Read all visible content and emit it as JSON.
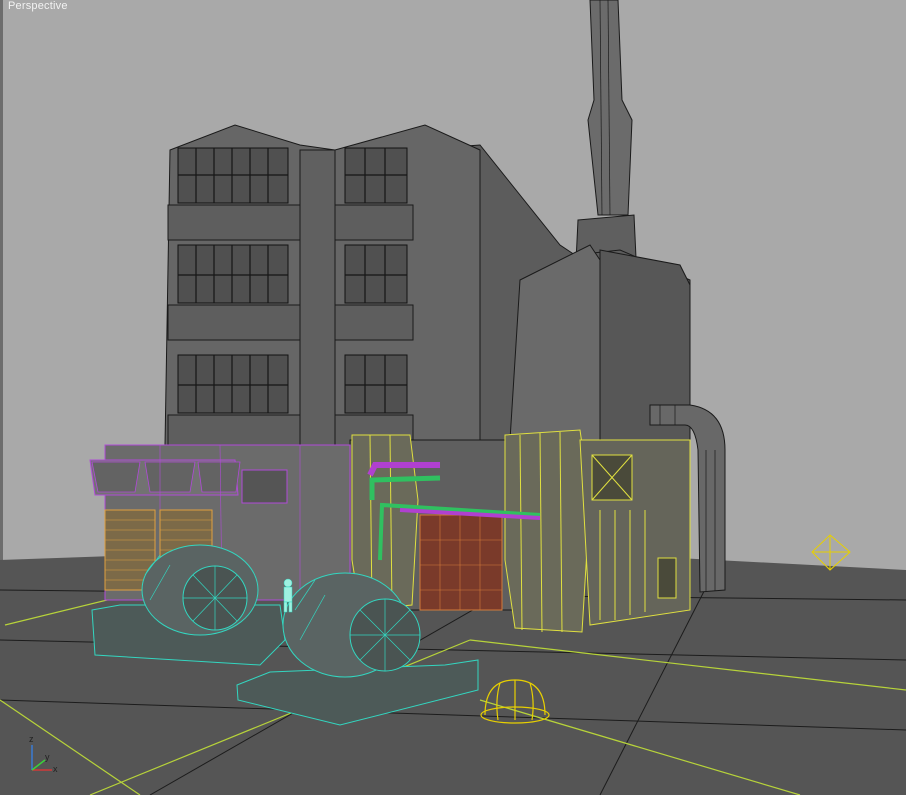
{
  "viewport": {
    "label": "Perspective",
    "background_color": "#a9a9a9",
    "grid_color": "#222222",
    "ground_line_color": "#b7d33a"
  },
  "scene": {
    "objects": [
      {
        "name": "factory-building",
        "type": "mesh",
        "wire_color": "#1a1a1a",
        "selected": false
      },
      {
        "name": "smokestack",
        "type": "mesh",
        "wire_color": "#1a1a1a",
        "selected": false
      },
      {
        "name": "purple-annex",
        "type": "mesh",
        "wire_color": "#a040c8",
        "selected": true
      },
      {
        "name": "teal-generator-left",
        "type": "mesh",
        "wire_color": "#2fd0b4",
        "selected": true
      },
      {
        "name": "teal-generator-right",
        "type": "mesh",
        "wire_color": "#2fd0b4",
        "selected": true
      },
      {
        "name": "yellow-wing",
        "type": "mesh",
        "wire_color": "#d8d840",
        "selected": true
      },
      {
        "name": "pipe-elbow",
        "type": "mesh",
        "wire_color": "#1a1a1a",
        "selected": false
      },
      {
        "name": "dome-light",
        "type": "helper",
        "wire_color": "#e8d000",
        "selected": false
      },
      {
        "name": "octahedron-helper",
        "type": "helper",
        "wire_color": "#e8d000",
        "selected": false
      },
      {
        "name": "human-figure",
        "type": "mesh",
        "wire_color": "#9ff0e0",
        "selected": false
      }
    ],
    "accent_colors": {
      "selection_purple": "#b04ad8",
      "selection_teal": "#33d6c0",
      "selection_yellow": "#e0e040",
      "pipe_green": "#30c060",
      "pipe_purple": "#b040d0",
      "grid_orange": "#d27a3a"
    }
  },
  "axis_gizmo": {
    "x_label": "x",
    "y_label": "y",
    "z_label": "z"
  }
}
